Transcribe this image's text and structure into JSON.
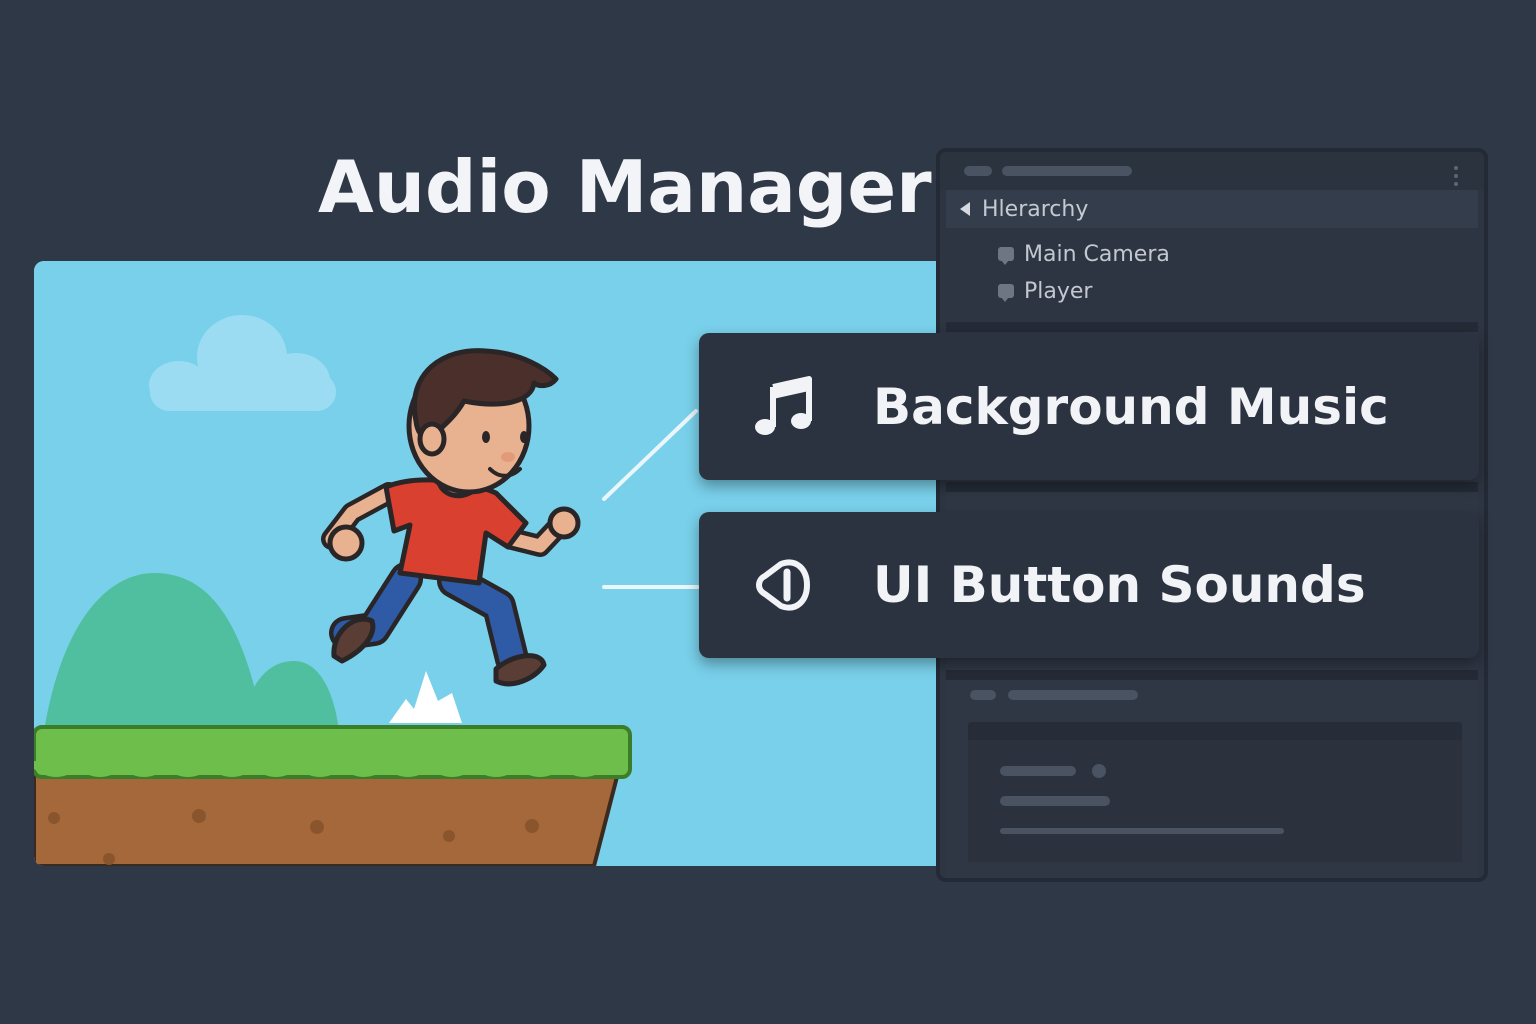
{
  "title": "Audio Manager",
  "hierarchy": {
    "title": "Hlerarchy",
    "items": [
      {
        "label": "Main Camera",
        "icon": "gameobject-icon"
      },
      {
        "label": "Player",
        "icon": "gameobject-icon"
      }
    ]
  },
  "audio_cards": [
    {
      "label": "Background Music",
      "icon": "music-note-icon"
    },
    {
      "label": "UI Button Sounds",
      "icon": "speaker-icon"
    }
  ],
  "colors": {
    "background": "#2f3846",
    "panel": "#2d3542",
    "card": "#2b3340",
    "sky": "#79d0ea",
    "grass": "#6dbe4b",
    "dirt": "#a5683a",
    "shirt": "#d9402f",
    "pants": "#2f5aa5"
  }
}
